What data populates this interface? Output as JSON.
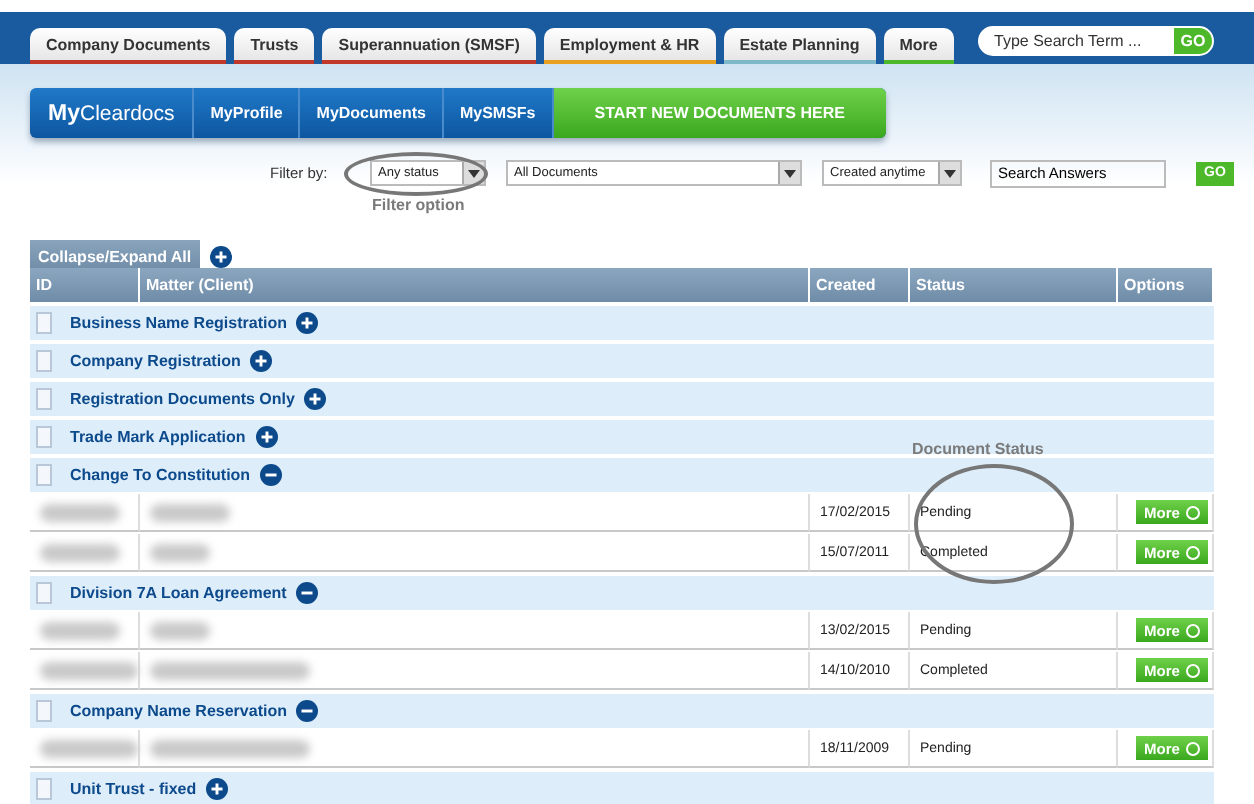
{
  "top_tabs": [
    {
      "label": "Company Documents",
      "color": "#c0392b"
    },
    {
      "label": "Trusts",
      "color": "#c0392b"
    },
    {
      "label": "Superannuation (SMSF)",
      "color": "#c0392b"
    },
    {
      "label": "Employment & HR",
      "color": "#e8a020"
    },
    {
      "label": "Estate Planning",
      "color": "#7fb8c8"
    },
    {
      "label": "More",
      "color": "#4cb82a"
    }
  ],
  "top_search": {
    "placeholder": "Type Search Term ...",
    "button": "GO"
  },
  "nav": {
    "logo_bold": "My",
    "logo_rest": "Cleardocs",
    "items": [
      {
        "label": "MyProfile",
        "kind": "link"
      },
      {
        "label": "MyDocuments",
        "kind": "link"
      },
      {
        "label": "MySMSFs",
        "kind": "link"
      },
      {
        "label": "START NEW DOCUMENTS HERE",
        "kind": "cta"
      }
    ]
  },
  "filters": {
    "label": "Filter by:",
    "status": "Any status",
    "documents": "All Documents",
    "created": "Created anytime",
    "search": "Search Answers",
    "button": "GO",
    "annotation": "Filter option"
  },
  "collapse_button": "Collapse/Expand All",
  "table": {
    "columns": [
      "ID",
      "Matter (Client)",
      "Created",
      "Status",
      "Options"
    ],
    "annotation": "Document Status",
    "groups": [
      {
        "name": "Business Name Registration",
        "expanded": false
      },
      {
        "name": "Company Registration",
        "expanded": false
      },
      {
        "name": "Registration Documents Only",
        "expanded": false
      },
      {
        "name": "Trade Mark Application",
        "expanded": false
      },
      {
        "name": "Change To Constitution",
        "expanded": true,
        "rows": [
          {
            "created": "17/02/2015",
            "status": "Pending",
            "button": "More"
          },
          {
            "created": "15/07/2011",
            "status": "Completed",
            "button": "More"
          }
        ]
      },
      {
        "name": "Division 7A Loan Agreement",
        "expanded": true,
        "rows": [
          {
            "created": "13/02/2015",
            "status": "Pending",
            "button": "More"
          },
          {
            "created": "14/10/2010",
            "status": "Completed",
            "button": "More"
          }
        ]
      },
      {
        "name": "Company Name Reservation",
        "expanded": true,
        "rows": [
          {
            "created": "18/11/2009",
            "status": "Pending",
            "button": "More"
          }
        ]
      },
      {
        "name": "Unit Trust - fixed",
        "expanded": false
      }
    ]
  }
}
